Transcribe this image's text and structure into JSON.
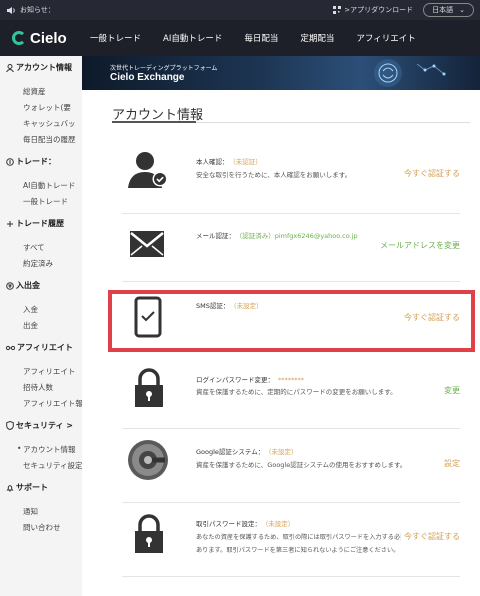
{
  "topbar": {
    "notice": "お知らせ：",
    "app_download": ">アプリダウンロード",
    "language": "日本語"
  },
  "nav": {
    "logo": "Cielo",
    "items": [
      "一般トレード",
      "AI自動トレード",
      "毎日配当",
      "定期配当",
      "アフィリエイト"
    ]
  },
  "banner": {
    "subtitle": "次世代トレーディングプラットフォーム",
    "title": "Cielo Exchange"
  },
  "sidebar": {
    "account": {
      "head": "アカウント情報",
      "items": [
        "総資産",
        "ウォレット(要",
        "キャッシュバッ",
        "毎日配当の履歴"
      ]
    },
    "trade": {
      "head": "トレード：",
      "items": [
        "AI自動トレード",
        "一般トレード"
      ]
    },
    "history": {
      "head": "トレード履歴",
      "items": [
        "すべて",
        "約定済み"
      ]
    },
    "deposit": {
      "head": "入出金",
      "items": [
        "入金",
        "出金"
      ]
    },
    "affiliate": {
      "head": "アフィリエイト",
      "items": [
        "アフィリエイト",
        "招待人数",
        "アフィリエイト報"
      ]
    },
    "security": {
      "head": "セキュリティ >",
      "items": [
        "アカウント情報",
        "セキュリティ設定"
      ]
    },
    "support": {
      "head": "サポート",
      "items": [
        "通知",
        "問い合わせ"
      ]
    }
  },
  "page_title": "アカウント情報",
  "cards": {
    "identity": {
      "label": "本人確認：",
      "status": "（未認証）",
      "desc": "安全な取引を行うために、本人確認をお願いします。",
      "action": "今すぐ認証する"
    },
    "email": {
      "label": "メール認証：",
      "status": "（認証済み）pimfgx6246@yahoo.co.jp",
      "action": "メールアドレスを変更"
    },
    "sms": {
      "label": "SMS認証：",
      "status": "（未設定）",
      "action": "今すぐ認証する"
    },
    "login_pw": {
      "label": "ログインパスワード変更：",
      "status": "********",
      "desc": "資産を保護するために、定期的にパスワードの変更をお願いします。",
      "action": "変更"
    },
    "google": {
      "label": "Google認証システム：",
      "status": "（未設定）",
      "desc": "資産を保護するために、Google認証システムの使用をおすすめします。",
      "action": "設定"
    },
    "trade_pw": {
      "label": "取引パスワード設定：",
      "status": "（未設定）",
      "desc1": "あなたの資産を保護するため、取引の際には取引パスワードを入力する必要が",
      "desc2": "あります。取引パスワードを第三者に知られないようにご注意ください。",
      "action": "今すぐ認証する"
    }
  },
  "colors": {
    "accent_gold": "#d4a058",
    "accent_green": "#6ab04c",
    "highlight_red": "#e04048",
    "logo_teal": "#2fc69d"
  }
}
